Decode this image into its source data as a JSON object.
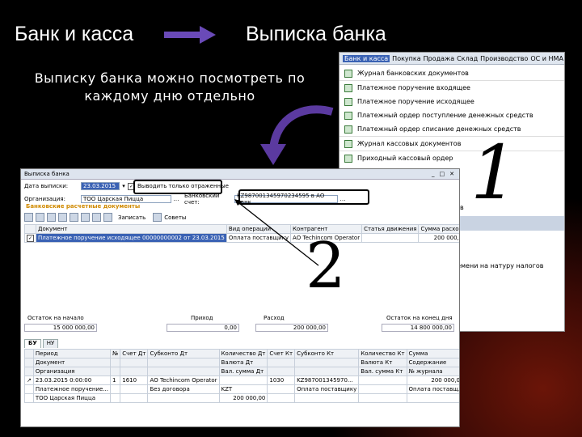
{
  "slide": {
    "heading_left": "Банк и касса",
    "heading_right": "Выписка банка",
    "subtitle": "Выписку банка можно посмотреть по каждому дню отдельно",
    "accent_color": "#5b3aa0",
    "marker_1": "1",
    "marker_2": "2"
  },
  "menu_window": {
    "menubar": [
      "Банк и касса",
      "Покупка",
      "Продажа",
      "Склад",
      "Производство",
      "ОС и НМА"
    ],
    "items": [
      "Журнал банковских документов",
      "Платежное поручение входящее",
      "Платежное поручение исходящее",
      "Платежный ордер поступление денежных средств",
      "Платежный ордер списание денежных средств",
      "Журнал кассовых документов",
      "Приходный кассовый ордер"
    ],
    "extra_items": [
      "ств",
      "ремени на натуру налогов",
      "ов"
    ]
  },
  "main_window": {
    "title": "Выписка банка",
    "date_label": "Дата выписки:",
    "date_value": "23.03.2015",
    "only_unposted_label": "Выводить только отраженные",
    "org_label": "Организация:",
    "org_value": "ТОО Царская Пицца",
    "account_label": "Банковский счет:",
    "account_value": "KZ987001345970234595 в АО Банк...",
    "section_title": "Банковские расчетные документы",
    "toolbar": {
      "post_label": "Записать",
      "tips_label": "Советы"
    },
    "docs_columns": [
      "Документ",
      "Вид операции",
      "Контрагент",
      "Статья движения",
      "Сумма расхода"
    ],
    "docs_rows": [
      [
        "Платежное поручение исходящее 00000000002 от 23.03.2015",
        "Оплата поставщику",
        "АО Techincom Operator",
        "",
        "200 000,00"
      ]
    ],
    "totals": [
      {
        "label": "Остаток на начало",
        "value": "15 000 000,00"
      },
      {
        "label": "Приход",
        "value": "0,00"
      },
      {
        "label": "Расход",
        "value": "200 000,00"
      },
      {
        "label": "Остаток на конец дня",
        "value": "14 800 000,00"
      }
    ],
    "tabs": [
      "БУ",
      "НУ"
    ],
    "entries_columns": [
      "Период",
      "№",
      "Счет Дт",
      "Субконто Дт",
      "Количество Дт",
      "Счет Кт",
      "Субконто Кт",
      "Количество Кт",
      "Сумма"
    ],
    "entries_columns_2": [
      "Документ",
      "",
      "",
      "",
      "Валюта Дт",
      "",
      "",
      "Валюта Кт",
      "Содержание"
    ],
    "entries_columns_3": [
      "Организация",
      "",
      "",
      "",
      "Вал. сумма Дт",
      "",
      "",
      "Вал. сумма Кт",
      "№ журнала"
    ],
    "entries_rows": [
      [
        "23.03.2015 0:00:00",
        "1",
        "1610",
        "АО Techincom Operator",
        "",
        "1030",
        "KZ987001345970...",
        "",
        "200 000,00"
      ],
      [
        "Платежное поручение...",
        "",
        "",
        "Без договора",
        "KZT",
        "",
        "Оплата поставщику",
        "",
        "Оплата поставщ..."
      ],
      [
        "ТОО Царская Пицца",
        "",
        "",
        "",
        "200 000,00",
        "",
        "",
        "",
        ""
      ]
    ]
  }
}
